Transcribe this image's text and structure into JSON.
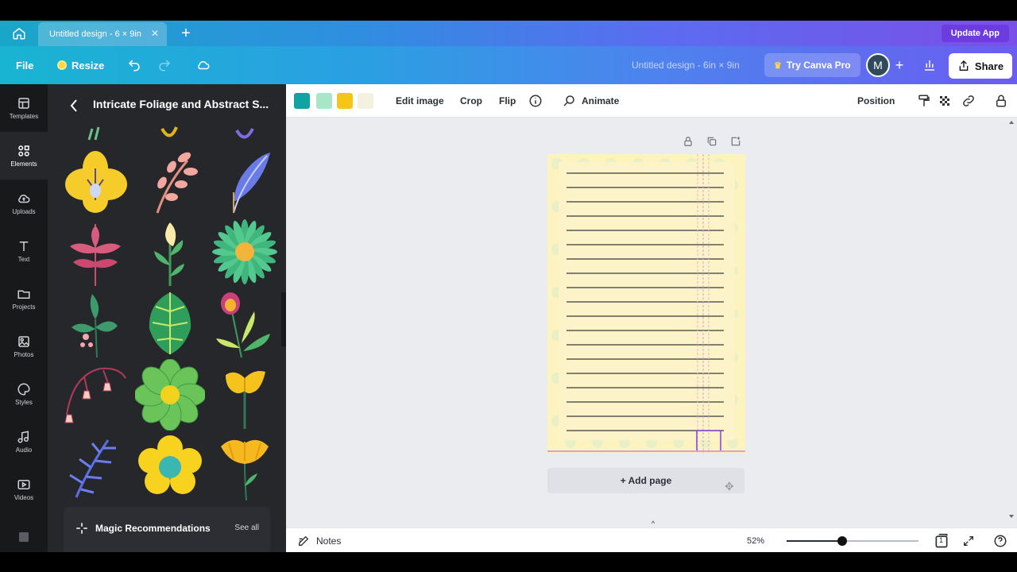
{
  "tabbar": {
    "tab_label": "Untitled design - 6 × 9in",
    "update_app_label": "Update App"
  },
  "header": {
    "file_label": "File",
    "resize_label": "Resize",
    "doc_title": "Untitled design - 6in × 9in",
    "try_pro_label": "Try Canva Pro",
    "avatar_initial": "M",
    "share_label": "Share"
  },
  "rail": {
    "items": [
      {
        "label": "Templates",
        "icon": "layout-icon"
      },
      {
        "label": "Elements",
        "icon": "shapes-icon"
      },
      {
        "label": "Uploads",
        "icon": "cloud-upload-icon"
      },
      {
        "label": "Text",
        "icon": "text-icon"
      },
      {
        "label": "Projects",
        "icon": "folder-icon"
      },
      {
        "label": "Photos",
        "icon": "image-icon"
      },
      {
        "label": "Styles",
        "icon": "palette-icon"
      },
      {
        "label": "Audio",
        "icon": "music-icon"
      },
      {
        "label": "Videos",
        "icon": "video-icon"
      }
    ],
    "active_index": 1
  },
  "panel": {
    "title": "Intricate Foliage and Abstract S...",
    "magic_title": "Magic Recommendations",
    "see_all": "See all"
  },
  "ctxbar": {
    "swatches": [
      "#0fa3a3",
      "#a8e6c8",
      "#f5c518",
      "#f4f1df"
    ],
    "edit_image": "Edit image",
    "crop": "Crop",
    "flip": "Flip",
    "animate": "Animate",
    "position": "Position"
  },
  "canvas": {
    "add_page": "+ Add page",
    "page_color": "#fdf3bf"
  },
  "bottombar": {
    "notes": "Notes",
    "zoom": "52%",
    "zoom_fraction": 0.42,
    "page_count": "1"
  }
}
